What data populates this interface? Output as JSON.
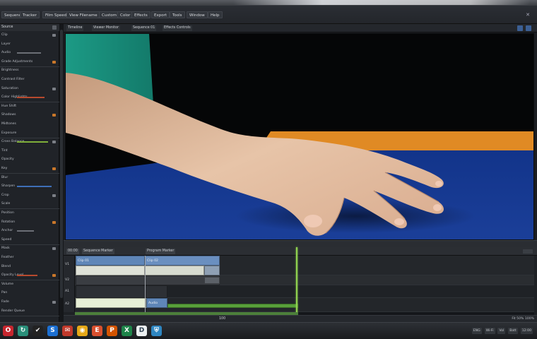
{
  "menubar": {
    "items": [
      "Sequence",
      "Tracker",
      "Film Speed",
      "View Filename",
      "Custom",
      "Color",
      "Effects",
      "Export",
      "Tools",
      "Window",
      "Help"
    ]
  },
  "left_panel": {
    "header": "Source",
    "rows": [
      "Clip",
      "Layer",
      "Audio",
      "Grade Adjustments",
      "Brightness",
      "Contrast Filter",
      "Saturation",
      "Color Highlights",
      "Hue Shift",
      "Shadows",
      "Midtones",
      "Exposure",
      "Cross Balance",
      "Tint",
      "Opacity",
      "Key",
      "Blur",
      "Sharpen",
      "Crop",
      "Scale",
      "Position",
      "Rotation",
      "Anchor",
      "Speed",
      "Mask",
      "Feather",
      "Blend",
      "Opacity Level",
      "Volume",
      "Pan",
      "Fade",
      "Render Queue"
    ]
  },
  "viewer": {
    "tabs": [
      "Timeline",
      "Viewer Monitor",
      "Sequence 01",
      "Effects Controls"
    ]
  },
  "timeline": {
    "ruler_labels": [
      "00:00",
      "Sequence Marker",
      "Program Marker"
    ],
    "track_labels": [
      "V1",
      "V2",
      "A1",
      "A2"
    ],
    "clips": [
      "Clip 01",
      "Clip 02",
      "Audio"
    ],
    "footer_center": "100",
    "footer_right": [
      "Fit",
      "50%",
      "100%"
    ]
  },
  "taskbar": {
    "apps": [
      {
        "icon": "opera-icon",
        "glyph": "O",
        "color": "#c6262e"
      },
      {
        "icon": "sync-icon",
        "glyph": "↻",
        "color": "#2a8f7a"
      },
      {
        "icon": "checkmark-icon",
        "glyph": "✔",
        "color": "#222"
      },
      {
        "icon": "store-icon",
        "glyph": "S",
        "color": "#1c6fd1"
      },
      {
        "icon": "mail-icon",
        "glyph": "✉",
        "color": "#c0392b"
      },
      {
        "icon": "chrome-icon",
        "glyph": "◉",
        "color": "#e6a817"
      },
      {
        "icon": "editor-icon",
        "glyph": "E",
        "color": "#d9502f"
      },
      {
        "icon": "presentation-icon",
        "glyph": "P",
        "color": "#d35400"
      },
      {
        "icon": "spreadsheet-icon",
        "glyph": "X",
        "color": "#1e8449"
      },
      {
        "icon": "document-icon",
        "glyph": "D",
        "color": "#ecf0f1"
      },
      {
        "icon": "shield-icon",
        "glyph": "⛨",
        "color": "#2e86c1"
      }
    ],
    "tray": [
      "ENG",
      "Wi-Fi",
      "Vol",
      "Batt",
      "12:00"
    ]
  },
  "colors": {
    "accent_green": "#8fd14f",
    "clip_blue": "#5f86b8",
    "panel_bg": "#202328"
  }
}
